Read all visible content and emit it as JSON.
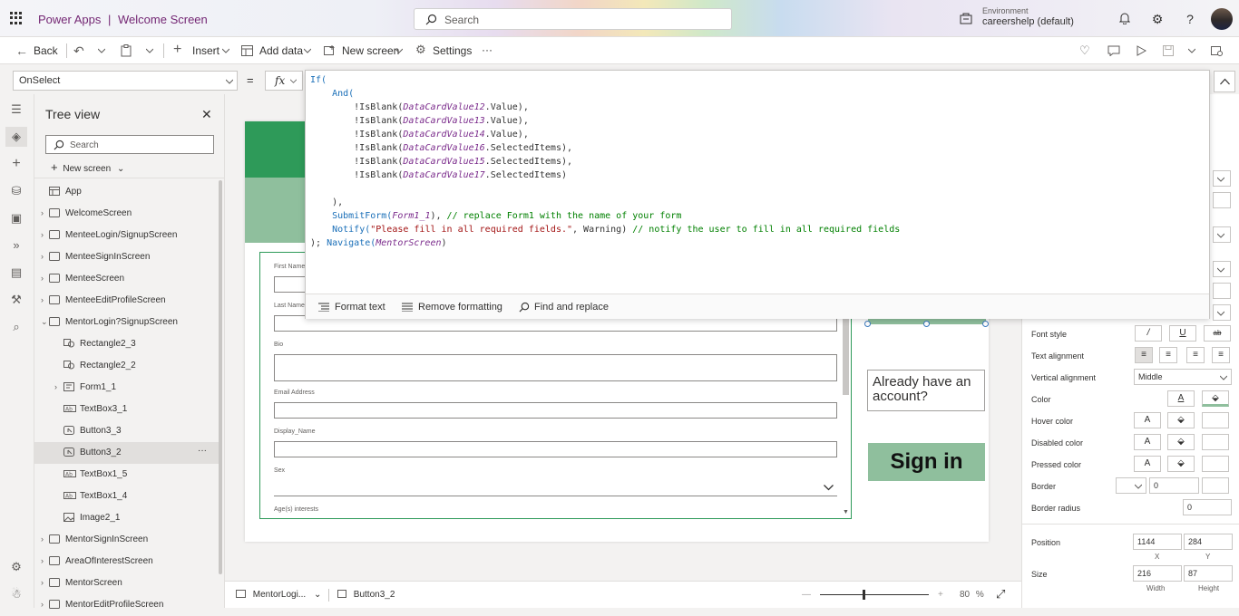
{
  "header": {
    "app_name": "Power Apps",
    "separator": "|",
    "screen_title": "Welcome Screen",
    "search_placeholder": "Search",
    "environment_label": "Environment",
    "environment_value": "careershelp (default)"
  },
  "commandbar": {
    "back": "Back",
    "insert": "Insert",
    "add_data": "Add data",
    "new_screen": "New screen",
    "settings": "Settings",
    "more": "···"
  },
  "formula_bar": {
    "property": "OnSelect",
    "equals": "=",
    "fx": "fx"
  },
  "formula": {
    "lines": [
      [
        {
          "t": "If(",
          "c": "kw"
        }
      ],
      [
        {
          "t": "    "
        },
        {
          "t": "And(",
          "c": "kw"
        }
      ],
      [
        {
          "t": "        !IsBlank("
        },
        {
          "t": "DataCardValue12",
          "c": "ctl"
        },
        {
          "t": ".Value),"
        }
      ],
      [
        {
          "t": "        !IsBlank("
        },
        {
          "t": "DataCardValue13",
          "c": "ctl"
        },
        {
          "t": ".Value),"
        }
      ],
      [
        {
          "t": "        !IsBlank("
        },
        {
          "t": "DataCardValue14",
          "c": "ctl"
        },
        {
          "t": ".Value),"
        }
      ],
      [
        {
          "t": "        !IsBlank("
        },
        {
          "t": "DataCardValue16",
          "c": "ctl"
        },
        {
          "t": ".SelectedItems),"
        }
      ],
      [
        {
          "t": "        !IsBlank("
        },
        {
          "t": "DataCardValue15",
          "c": "ctl"
        },
        {
          "t": ".SelectedItems),"
        }
      ],
      [
        {
          "t": "        !IsBlank("
        },
        {
          "t": "DataCardValue17",
          "c": "ctl"
        },
        {
          "t": ".SelectedItems)"
        }
      ],
      [
        {
          "t": ""
        }
      ],
      [
        {
          "t": "    ),"
        }
      ],
      [
        {
          "t": "    "
        },
        {
          "t": "SubmitForm(",
          "c": "kw"
        },
        {
          "t": "Form1_1",
          "c": "ctl"
        },
        {
          "t": "), "
        },
        {
          "t": "// replace Form1 with the name of your form",
          "c": "cmt"
        }
      ],
      [
        {
          "t": "    "
        },
        {
          "t": "Notify(",
          "c": "kw"
        },
        {
          "t": "\"Please fill in all required fields.\"",
          "c": "str"
        },
        {
          "t": ", Warning) "
        },
        {
          "t": "// notify the user to fill in all required fields",
          "c": "cmt"
        }
      ],
      [
        {
          "t": "); "
        },
        {
          "t": "Navigate(",
          "c": "kw"
        },
        {
          "t": "MentorScreen",
          "c": "ctl"
        },
        {
          "t": ")"
        }
      ]
    ],
    "footer": {
      "format_text": "Format text",
      "remove_formatting": "Remove formatting",
      "find_replace": "Find and replace"
    }
  },
  "tree": {
    "title": "Tree view",
    "search_placeholder": "Search",
    "new_screen": "New screen",
    "items": [
      {
        "label": "App",
        "indent": 0,
        "icon": "app",
        "caret": ""
      },
      {
        "label": "WelcomeScreen",
        "indent": 0,
        "icon": "screen",
        "caret": "›"
      },
      {
        "label": "MenteeLogin/SignupScreen",
        "indent": 0,
        "icon": "screen",
        "caret": "›"
      },
      {
        "label": "MenteeSignInScreen",
        "indent": 0,
        "icon": "screen",
        "caret": "›"
      },
      {
        "label": "MenteeScreen",
        "indent": 0,
        "icon": "screen",
        "caret": "›"
      },
      {
        "label": "MenteeEditProfileScreen",
        "indent": 0,
        "icon": "screen",
        "caret": "›"
      },
      {
        "label": "MentorLogin?SignupScreen",
        "indent": 0,
        "icon": "screen",
        "caret": "⌄"
      },
      {
        "label": "Rectangle2_3",
        "indent": 1,
        "icon": "shape",
        "caret": ""
      },
      {
        "label": "Rectangle2_2",
        "indent": 1,
        "icon": "shape",
        "caret": ""
      },
      {
        "label": "Form1_1",
        "indent": 1,
        "icon": "form",
        "caret": "›"
      },
      {
        "label": "TextBox3_1",
        "indent": 1,
        "icon": "textbox",
        "caret": ""
      },
      {
        "label": "Button3_3",
        "indent": 1,
        "icon": "button",
        "caret": ""
      },
      {
        "label": "Button3_2",
        "indent": 1,
        "icon": "button",
        "caret": "",
        "selected": true,
        "more": "···"
      },
      {
        "label": "TextBox1_5",
        "indent": 1,
        "icon": "textbox",
        "caret": ""
      },
      {
        "label": "TextBox1_4",
        "indent": 1,
        "icon": "textbox",
        "caret": ""
      },
      {
        "label": "Image2_1",
        "indent": 1,
        "icon": "image",
        "caret": ""
      },
      {
        "label": "MentorSignInScreen",
        "indent": 0,
        "icon": "screen",
        "caret": "›"
      },
      {
        "label": "AreaOfInterestScreen",
        "indent": 0,
        "icon": "screen",
        "caret": "›"
      },
      {
        "label": "MentorScreen",
        "indent": 0,
        "icon": "screen",
        "caret": "›"
      },
      {
        "label": "MentorEditProfileScreen",
        "indent": 0,
        "icon": "screen",
        "caret": "›"
      }
    ]
  },
  "form": {
    "fields": [
      {
        "label": "First Name"
      },
      {
        "label": "Last Name"
      },
      {
        "label": "Bio",
        "tall": true
      },
      {
        "label": "Email Address"
      },
      {
        "label": "Display_Name"
      },
      {
        "label": "Sex",
        "dropdown": true
      },
      {
        "label": "Age(s) interests"
      }
    ]
  },
  "canvas": {
    "already_text": "Already have an account?",
    "signin_label": "Sign in"
  },
  "properties": {
    "font_style": "Font style",
    "text_alignment": "Text alignment",
    "vertical_alignment": "Vertical alignment",
    "vertical_alignment_value": "Middle",
    "color": "Color",
    "hover_color": "Hover color",
    "disabled_color": "Disabled color",
    "pressed_color": "Pressed color",
    "border": "Border",
    "border_value": "0",
    "border_radius": "Border radius",
    "border_radius_value": "0",
    "position": "Position",
    "position_x": "1144",
    "position_y": "284",
    "x_label": "X",
    "y_label": "Y",
    "size": "Size",
    "width_value": "216",
    "height_value": "87",
    "width_label": "Width",
    "height_label": "Height",
    "font_style_buttons": [
      "/",
      "U",
      "ab"
    ],
    "color_glyph": "A"
  },
  "bottombar": {
    "screen_tab": "MentorLogi...",
    "control_tab": "Button3_2",
    "minus": "—",
    "plus": "+",
    "zoom_value": "80",
    "zoom_unit": "%"
  },
  "colors": {
    "accent": "#742774",
    "green_dark": "#2e9a59",
    "green_light": "#8fbf9d",
    "selection": "#3d7bbf"
  }
}
